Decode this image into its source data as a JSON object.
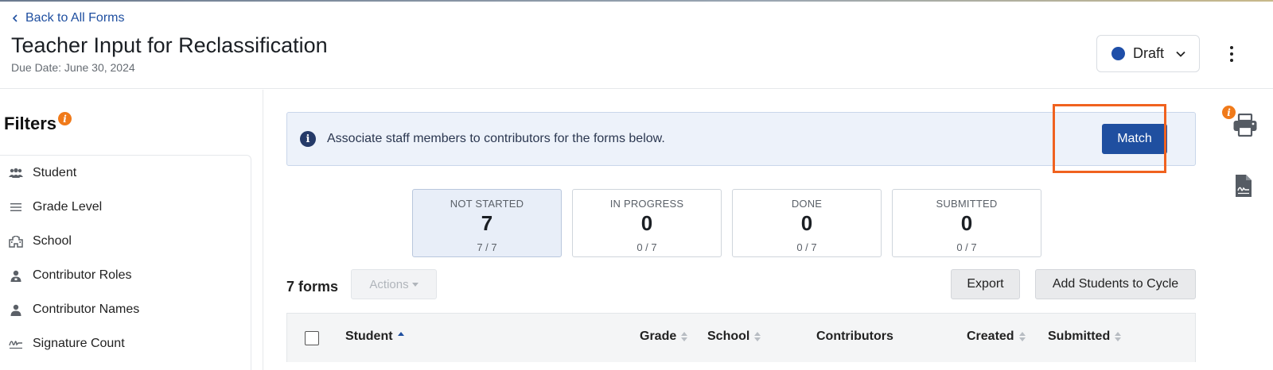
{
  "header": {
    "back_label": "Back to All Forms",
    "title": "Teacher Input for Reclassification",
    "due_date": "Due Date: June 30, 2024",
    "status_label": "Draft",
    "status_color": "#1e4ea8"
  },
  "sidebar": {
    "title": "Filters",
    "info_glyph": "i",
    "items": [
      {
        "label": "Student",
        "icon": "people-icon"
      },
      {
        "label": "Grade Level",
        "icon": "lines-icon"
      },
      {
        "label": "School",
        "icon": "school-icon"
      },
      {
        "label": "Contributor Roles",
        "icon": "person-badge-icon"
      },
      {
        "label": "Contributor Names",
        "icon": "person-icon"
      },
      {
        "label": "Signature Count",
        "icon": "signature-icon"
      }
    ]
  },
  "banner": {
    "info_glyph": "i",
    "text": "Associate staff members to contributors for the forms below.",
    "match_label": "Match"
  },
  "stats": [
    {
      "label": "NOT STARTED",
      "count": "7",
      "fraction": "7 / 7",
      "active": true
    },
    {
      "label": "IN PROGRESS",
      "count": "0",
      "fraction": "0 / 7",
      "active": false
    },
    {
      "label": "DONE",
      "count": "0",
      "fraction": "0 / 7",
      "active": false
    },
    {
      "label": "SUBMITTED",
      "count": "0",
      "fraction": "0 / 7",
      "active": false
    }
  ],
  "toolbar": {
    "forms_count": "7 forms",
    "actions_label": "Actions",
    "export_label": "Export",
    "add_label": "Add Students to Cycle"
  },
  "table": {
    "columns": [
      {
        "label": "Student",
        "sort": "asc"
      },
      {
        "label": "Grade",
        "sort": "none"
      },
      {
        "label": "School",
        "sort": "none"
      },
      {
        "label": "Contributors",
        "sort": ""
      },
      {
        "label": "Created",
        "sort": "none"
      },
      {
        "label": "Submitted",
        "sort": "none"
      }
    ]
  },
  "rail": {
    "info_glyph": "i"
  },
  "colors": {
    "accent": "#1f4fa0",
    "highlight": "#f0621f",
    "info_badge": "#f07a1a"
  }
}
